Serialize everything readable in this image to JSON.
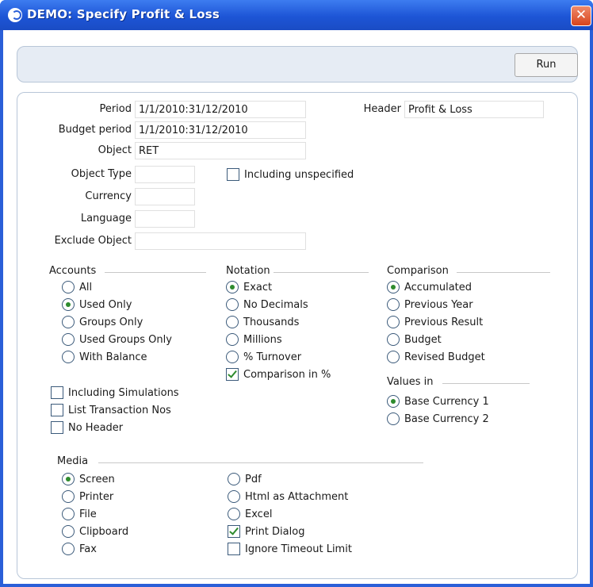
{
  "window": {
    "title": "DEMO: Specify Profit & Loss",
    "close_glyph": "✕"
  },
  "toolbar": {
    "run_label": "Run"
  },
  "fields": {
    "period": {
      "label": "Period",
      "value": "1/1/2010:31/12/2010"
    },
    "budget_period": {
      "label": "Budget period",
      "value": "1/1/2010:31/12/2010"
    },
    "object": {
      "label": "Object",
      "value": "RET"
    },
    "object_type": {
      "label": "Object Type",
      "value": ""
    },
    "currency": {
      "label": "Currency",
      "value": ""
    },
    "language": {
      "label": "Language",
      "value": ""
    },
    "exclude_object": {
      "label": "Exclude Object",
      "value": ""
    },
    "header": {
      "label": "Header",
      "value": "Profit & Loss"
    }
  },
  "including_unspecified": {
    "label": "Including unspecified",
    "checked": false
  },
  "accounts": {
    "title": "Accounts",
    "options": [
      "All",
      "Used Only",
      "Groups Only",
      "Used Groups Only",
      "With Balance"
    ],
    "selected": "Used Only"
  },
  "notation": {
    "title": "Notation",
    "options": [
      "Exact",
      "No Decimals",
      "Thousands",
      "Millions",
      "% Turnover"
    ],
    "selected": "Exact",
    "comparison_pct": {
      "label": "Comparison in %",
      "checked": true
    }
  },
  "comparison": {
    "title": "Comparison",
    "options": [
      "Accumulated",
      "Previous Year",
      "Previous Result",
      "Budget",
      "Revised Budget"
    ],
    "selected": "Accumulated"
  },
  "values_in": {
    "title": "Values in",
    "options": [
      "Base Currency 1",
      "Base Currency 2"
    ],
    "selected": "Base Currency 1"
  },
  "extra_checks": [
    {
      "label": "Including Simulations",
      "checked": false
    },
    {
      "label": "List Transaction Nos",
      "checked": false
    },
    {
      "label": "No Header",
      "checked": false
    }
  ],
  "media": {
    "title": "Media",
    "options_left": [
      "Screen",
      "Printer",
      "File",
      "Clipboard",
      "Fax"
    ],
    "options_right": [
      "Pdf",
      "Html as Attachment",
      "Excel"
    ],
    "selected": "Screen",
    "print_dialog": {
      "label": "Print Dialog",
      "checked": true
    },
    "ignore_timeout": {
      "label": "Ignore Timeout Limit",
      "checked": false
    }
  },
  "colors": {
    "titlebar": "#2a5fd8",
    "accent_check": "#2e8b2e"
  }
}
